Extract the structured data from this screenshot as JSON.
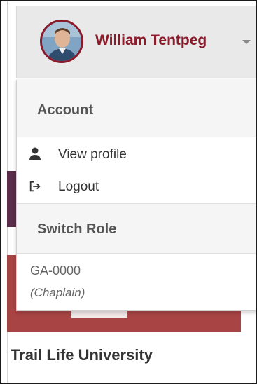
{
  "user": {
    "name": "William Tentpeg"
  },
  "dropdown": {
    "account_header": "Account",
    "items": [
      {
        "label": "View profile",
        "icon": "user-icon"
      },
      {
        "label": "Logout",
        "icon": "sign-out-icon"
      }
    ],
    "switch_role_header": "Switch Role",
    "role": {
      "code": "GA-0000",
      "name": "(Chaplain)"
    }
  },
  "background": {
    "title": "Trail Life University"
  },
  "colors": {
    "brand": "#8b1a2b",
    "header_bg": "#e9e9e9",
    "banner": "#a84444"
  }
}
